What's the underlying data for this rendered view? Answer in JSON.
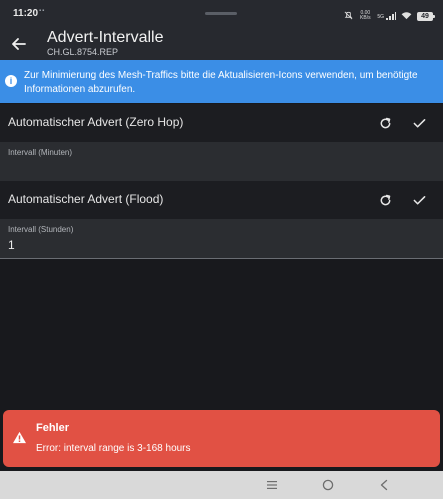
{
  "status": {
    "time": "11:20",
    "notif_dots": "▪▪",
    "speed_top": "0.00",
    "speed_bottom": "KB/s",
    "signal_label": "5G",
    "battery": "49"
  },
  "appbar": {
    "title": "Advert-Intervalle",
    "subtitle": "CH.GL.8754.REP",
    "back_icon": "arrow-left-icon"
  },
  "info_banner": {
    "icon": "info-icon",
    "text": "Zur Minimierung des Mesh-Traffics bitte die Aktualisieren-Icons verwenden, um benötigte Informationen abzurufen."
  },
  "sections": [
    {
      "title": "Automatischer Advert (Zero Hop)",
      "refresh_icon": "refresh-icon",
      "confirm_icon": "check-icon",
      "field_label": "Intervall (Minuten)",
      "field_value": ""
    },
    {
      "title": "Automatischer Advert (Flood)",
      "refresh_icon": "refresh-icon",
      "confirm_icon": "check-icon",
      "field_label": "Intervall (Stunden)",
      "field_value": "1"
    }
  ],
  "error": {
    "icon": "warning-icon",
    "title": "Fehler",
    "message": "Error: interval range is 3-168 hours"
  },
  "navbar": {
    "items": [
      "menu-icon",
      "home-icon",
      "back-icon"
    ]
  },
  "colors": {
    "background": "#18191d",
    "appbar": "#27292f",
    "info": "#3b8ee6",
    "error": "#e15144",
    "field": "#2b2d31",
    "navbar": "#d9d9d9"
  }
}
